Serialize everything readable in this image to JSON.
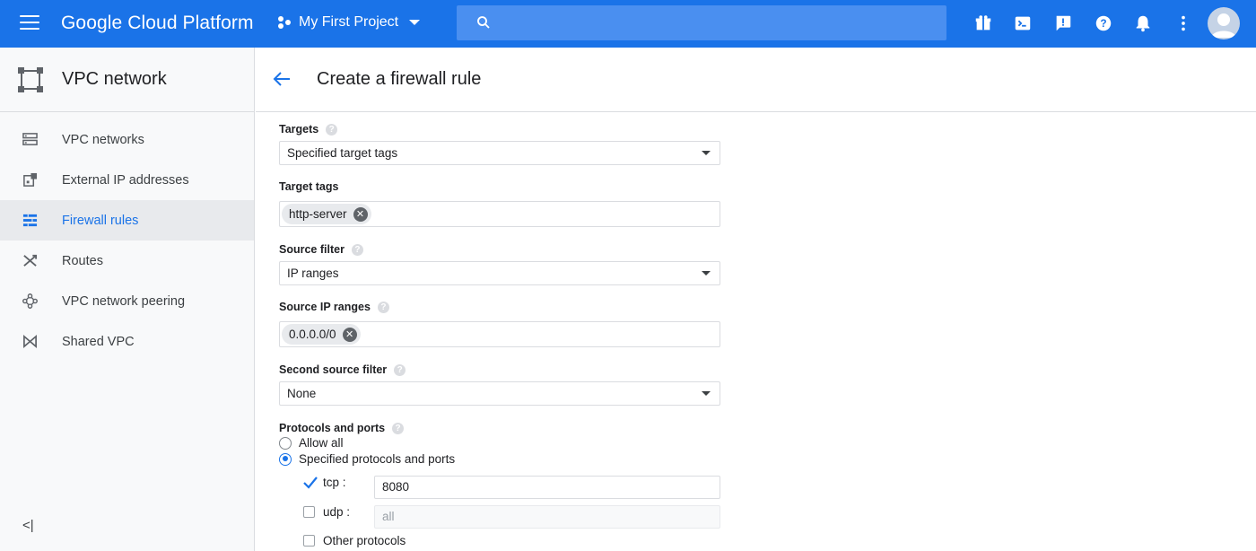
{
  "header": {
    "brand": "Google Cloud Platform",
    "project": "My First Project",
    "icons": [
      "gift-icon",
      "terminal-icon",
      "feedback-icon",
      "help-icon",
      "notifications-icon",
      "more-vert-icon",
      "avatar"
    ],
    "accent": "#1a73e8"
  },
  "sidebar": {
    "title": "VPC network",
    "items": [
      {
        "label": "VPC networks",
        "icon": "vpc-networks-icon"
      },
      {
        "label": "External IP addresses",
        "icon": "external-ip-icon"
      },
      {
        "label": "Firewall rules",
        "icon": "firewall-icon",
        "active": true
      },
      {
        "label": "Routes",
        "icon": "routes-icon"
      },
      {
        "label": "VPC network peering",
        "icon": "peering-icon"
      },
      {
        "label": "Shared VPC",
        "icon": "shared-vpc-icon"
      }
    ],
    "collapse": "<|"
  },
  "page": {
    "title": "Create a firewall rule"
  },
  "form": {
    "targets": {
      "label": "Targets",
      "value": "Specified target tags"
    },
    "target_tags": {
      "label": "Target tags",
      "chip": "http-server"
    },
    "source_filter": {
      "label": "Source filter",
      "value": "IP ranges"
    },
    "source_ip_ranges": {
      "label": "Source IP ranges",
      "chip": "0.0.0.0/0"
    },
    "second_source_filter": {
      "label": "Second source filter",
      "value": "None"
    },
    "protocols": {
      "label": "Protocols and ports",
      "allow_all": "Allow all",
      "specified": "Specified protocols and ports",
      "selected": "specified",
      "tcp": {
        "label": "tcp :",
        "checked": true,
        "value": "8080"
      },
      "udp": {
        "label": "udp :",
        "checked": false,
        "placeholder": "all"
      },
      "other": {
        "label": "Other protocols",
        "checked": false
      }
    }
  }
}
